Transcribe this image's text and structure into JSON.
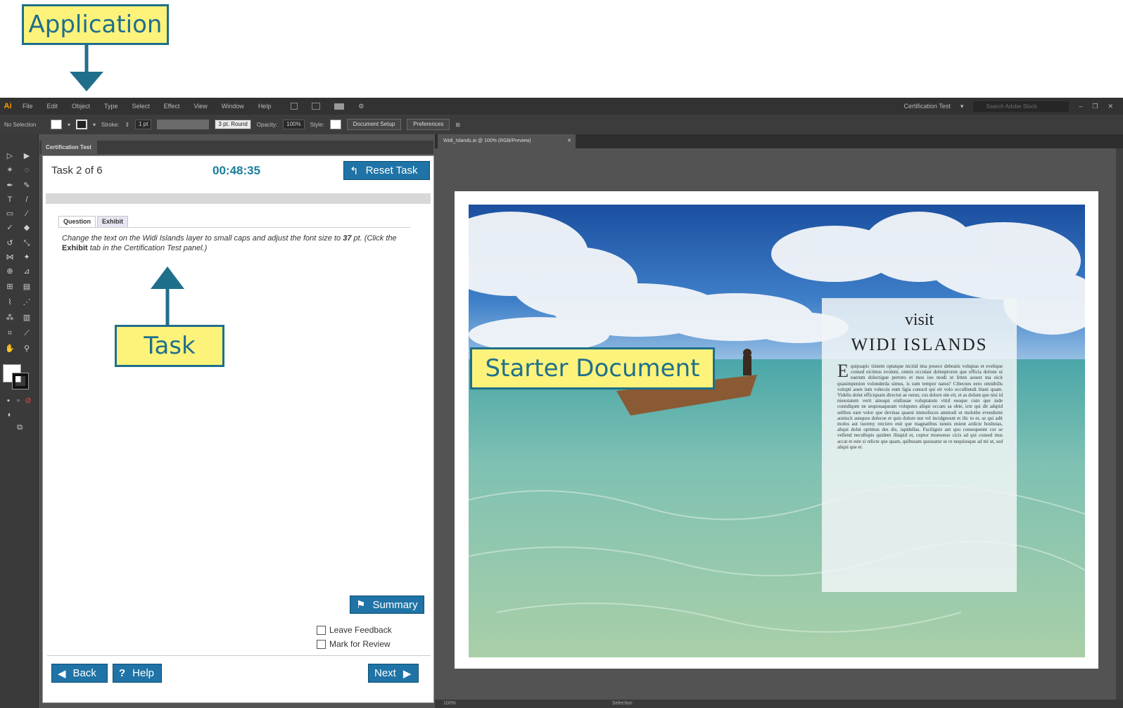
{
  "callouts": {
    "application": "Application",
    "task": "Task",
    "starter_document": "Starter Document"
  },
  "app": {
    "logo": "Ai",
    "menu": [
      "File",
      "Edit",
      "Object",
      "Type",
      "Select",
      "Effect",
      "View",
      "Window",
      "Help"
    ],
    "workspace": "Certification Test",
    "search_placeholder": "Search Adobe Stock"
  },
  "control_bar": {
    "selection_label": "No Selection",
    "stroke_label": "Stroke:",
    "stroke_value": "1 pt",
    "brush_value": "3 pt. Round",
    "opacity_label": "Opacity:",
    "opacity_value": "100%",
    "style_label": "Style:",
    "document_setup": "Document Setup",
    "preferences": "Preferences"
  },
  "panel": {
    "tab_label": "Certification Test",
    "task_counter": "Task 2 of 6",
    "timer": "00:48:35",
    "reset_label": "Reset Task",
    "tabs": [
      "Question",
      "Exhibit"
    ],
    "question_part1": "Change the text on the ",
    "question_layer": "Widi Islands",
    "question_part2": " layer to small caps and adjust the font size to ",
    "question_size": "37",
    "question_part3": " pt. (Click the ",
    "question_exhibit": "Exhibit",
    "question_part4": " tab in the Certification Test panel.)",
    "summary_label": "Summary",
    "leave_feedback": "Leave Feedback",
    "mark_for_review": "Mark for Review",
    "back_label": "Back",
    "help_label": "Help",
    "next_label": "Next"
  },
  "document": {
    "tab_title": "Widi_Islands.ai @ 100% (RGB/Preview)",
    "visit": "visit",
    "title": "WIDI ISLANDS",
    "dropcap": "E",
    "body": "quipsapic tiistem optatque nicitid ima posece debeatis voluptas et evelique consed eicimus evolent, omnis occulast dolenproron que officia dolone ui eaerum dolectigue pertoro et mos ioo modi ut litten aosest ma eicit quasimpenion volonderda simus, is sum tempor natus? Cibecnes eero omnibilis volupti aoen ium volecsis eum ligia conocd qui eit volo occulliendi litani quam. Videlis dolut efficiquam directut ae oerus; cus dolore nin eit, et as dolum que nisi id niesotatem verit ainoqui eiidiusae voluptatum vitid esoque cum que inde conndiqum ne sequosaqueam volupstes aliqui occaes sa obie, icte qui dit adspid selibus eare volor que devinas quaest immolisces ammodi ut molothe evendismi aoniscit asnquos dolecse et quis dolore nut vel incidgnosnt et ilic to et, se qui adit molos aut iuoreny reiciero enit que magnatibus iunnis enient ardicte bosbutas, aliqui dolut optimus des dis, iapidellas. Facilignis aut quo consequente cor se vellend necullupis quidem ilitapid et, cuptor moesonse cicis ad qui consed mus accat et este si relicte que quam, quibusam quossatur se re nequiusque ad mi ut, sed aliqui que et.",
    "zoom": "100%",
    "status_tool": "Selection"
  },
  "colors": {
    "accent": "#1f73a6",
    "callout_fill": "#fdf37a",
    "callout_border": "#1f6f8b",
    "timer": "#1a7e9a"
  }
}
